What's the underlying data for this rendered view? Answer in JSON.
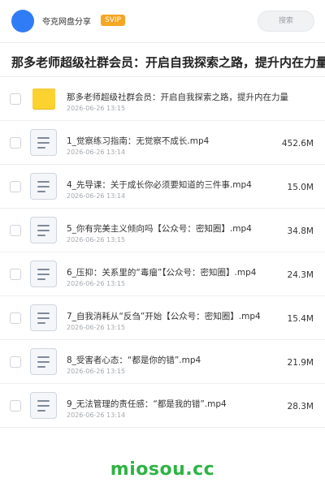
{
  "header": {
    "app_name": "夸克网盘分享",
    "badge": "SVIP",
    "search_label": "搜索"
  },
  "title": "那多老师超级社群会员：开启自我探索之路，提升内在力量",
  "files": [
    {
      "type": "folder",
      "icon": "folder-icon",
      "name": "那多老师超级社群会员：开启自我探索之路，提升内在力量",
      "date": "2026-06-26 13:15",
      "size": ""
    },
    {
      "type": "file",
      "icon": "document-icon",
      "name": "1_觉察练习指南：无觉察不成长.mp4",
      "date": "2026-06-26 13:14",
      "size": "452.6M"
    },
    {
      "type": "file",
      "icon": "document-icon",
      "name": "4_先导课：关于成长你必须要知道的三件事.mp4",
      "date": "2026-06-26 13:14",
      "size": "15.0M"
    },
    {
      "type": "file",
      "icon": "document-icon",
      "name": "5_你有完美主义倾向吗【公众号：密知圈】.mp4",
      "date": "2026-06-26 13:15",
      "size": "34.8M"
    },
    {
      "type": "file",
      "icon": "document-icon",
      "name": "6_压抑：关系里的“毒瘤”【公众号：密知圈】.mp4",
      "date": "2026-06-26 13:15",
      "size": "24.3M"
    },
    {
      "type": "file",
      "icon": "document-icon",
      "name": "7_自我消耗从“反刍”开始【公众号：密知圈】.mp4",
      "date": "2026-06-26 13:15",
      "size": "15.4M"
    },
    {
      "type": "file",
      "icon": "document-icon",
      "name": "8_受害者心态：“都是你的错”.mp4",
      "date": "2026-06-26 13:15",
      "size": "21.9M"
    },
    {
      "type": "file",
      "icon": "document-icon",
      "name": "9_无法管理的责任感：“都是我的错”.mp4",
      "date": "2026-06-26 13:14",
      "size": "28.3M"
    }
  ],
  "watermark": "miosou.cc",
  "colors": {
    "avatar": "#2f7cf6",
    "badge": "#f5a623",
    "folder": "#fcd22e",
    "watermark": "#2fb344"
  }
}
